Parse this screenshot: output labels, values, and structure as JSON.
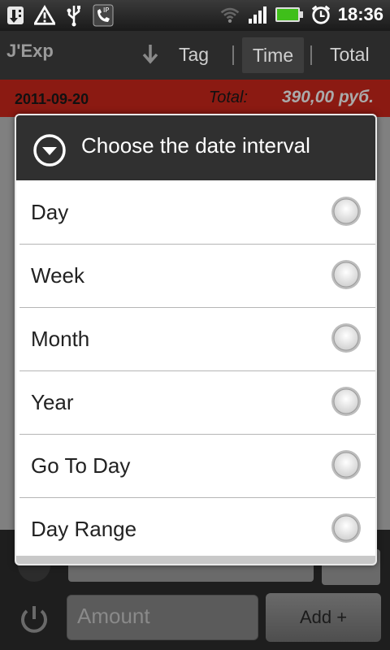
{
  "status_bar": {
    "icons_left": [
      "download-icon",
      "warning-icon",
      "usb-icon",
      "phone-ip-icon"
    ],
    "icons_right": [
      "wifi-icon",
      "signal-icon",
      "battery-icon",
      "alarm-icon"
    ],
    "time": "18:36"
  },
  "app_bar": {
    "title": "J'Exp",
    "tabs": [
      "Tag",
      "Time",
      "Total"
    ],
    "selected_tab": "Time"
  },
  "date_bar": {
    "date": "2011-09-20",
    "total_label": "Total:",
    "total_value": "390,00 руб."
  },
  "dialog": {
    "title": "Choose the date interval",
    "options": [
      "Day",
      "Week",
      "Month",
      "Year",
      "Go To Day",
      "Day Range"
    ]
  },
  "bottom": {
    "amount_placeholder": "Amount",
    "add_label": "Add +"
  },
  "colors": {
    "date_bar": "#8b1a12",
    "dialog_header": "#303030",
    "status_bar": "#1a1a1a"
  }
}
